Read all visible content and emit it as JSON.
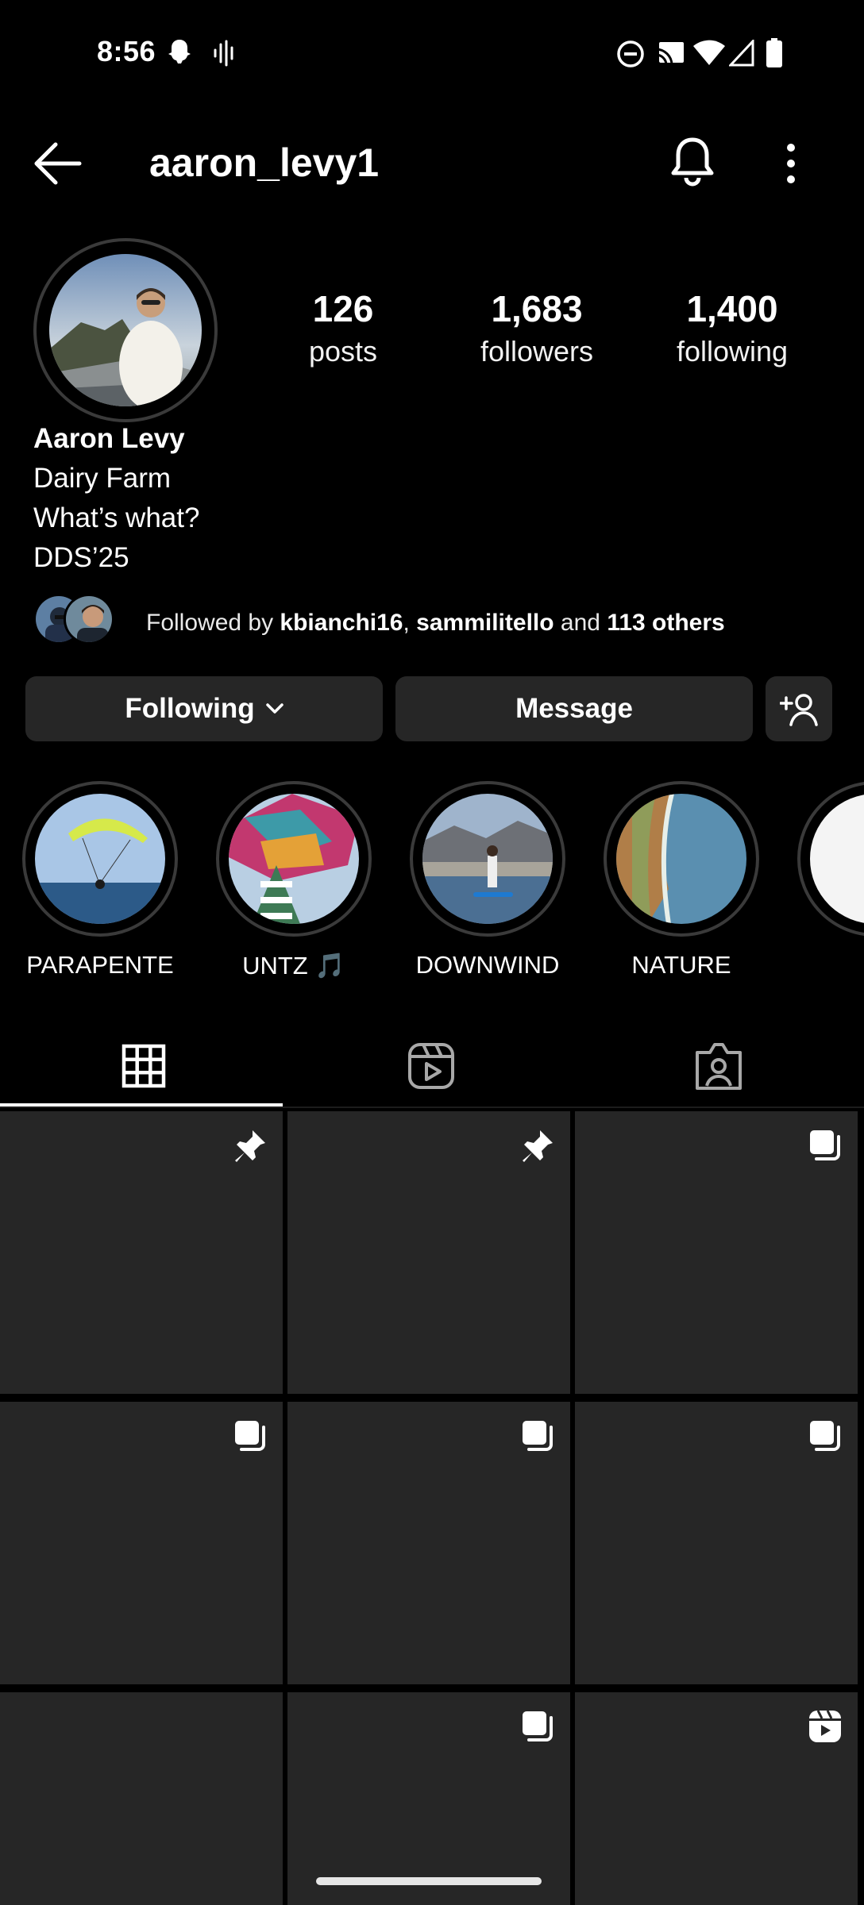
{
  "status_bar": {
    "time": "8:56",
    "left_icons": [
      "snapchat-icon",
      "voice-icon"
    ],
    "right_icons": [
      "dnd-icon",
      "cast-icon",
      "wifi-icon",
      "signal-icon",
      "battery-icon"
    ]
  },
  "header": {
    "username": "aaron_levy1",
    "icons": [
      "back-arrow-icon",
      "bell-icon",
      "more-vert-icon"
    ]
  },
  "profile": {
    "stats": [
      {
        "value": "126",
        "label": "posts"
      },
      {
        "value": "1,683",
        "label": "followers"
      },
      {
        "value": "1,400",
        "label": "following"
      }
    ],
    "name": "Aaron Levy",
    "bio_lines": [
      "Dairy Farm",
      "What’s what?",
      "DDS’25"
    ],
    "followed_by": {
      "prefix": "Followed by ",
      "user1": "kbianchi16",
      "sep": ", ",
      "user2": "sammilitello",
      "mid": " and ",
      "others": "113 others"
    }
  },
  "actions": {
    "following_label": "Following",
    "message_label": "Message",
    "add_friend_icon": "add-person-icon"
  },
  "highlights": [
    {
      "label": "PARAPENTE"
    },
    {
      "label": "UNTZ 🎵"
    },
    {
      "label": "DOWNWIND"
    },
    {
      "label": "NATURE"
    },
    {
      "label": ""
    }
  ],
  "tabs": [
    {
      "icon": "grid-icon",
      "selected": true
    },
    {
      "icon": "reels-icon",
      "selected": false
    },
    {
      "icon": "tagged-icon",
      "selected": false
    }
  ],
  "grid": [
    {
      "badge": "pin-icon"
    },
    {
      "badge": "pin-icon"
    },
    {
      "badge": "carousel-icon"
    },
    {
      "badge": "carousel-icon"
    },
    {
      "badge": "carousel-icon"
    },
    {
      "badge": "carousel-icon"
    },
    {
      "badge": ""
    },
    {
      "badge": "carousel-icon"
    },
    {
      "badge": "reel-icon"
    }
  ],
  "colors": {
    "background": "#000000",
    "surface": "#262626",
    "ring": "#3a3a3a",
    "text": "#ffffff"
  }
}
